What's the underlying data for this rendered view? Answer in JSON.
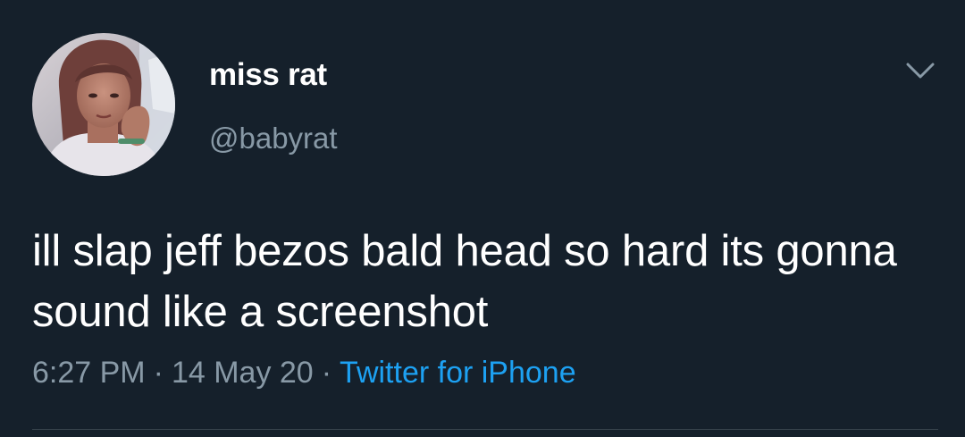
{
  "tweet": {
    "author": {
      "display_name": "miss rat",
      "handle": "@babyrat"
    },
    "text": "ill slap jeff bezos bald head so hard its gonna sound like a screenshot",
    "meta": {
      "time": "6:27 PM",
      "separator": "·",
      "date": "14 May 20",
      "source": "Twitter for iPhone"
    },
    "menu_icon": "chevron-down-icon"
  },
  "colors": {
    "background": "#15202b",
    "primary_text": "#ffffff",
    "secondary_text": "#8899a6",
    "link": "#1da1f2",
    "divider": "#38444d"
  }
}
